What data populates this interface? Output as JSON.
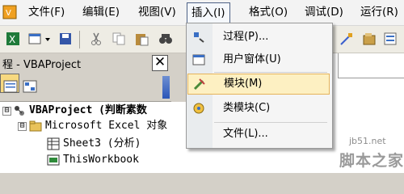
{
  "menubar": {
    "items": [
      {
        "label": "文件(F)"
      },
      {
        "label": "编辑(E)"
      },
      {
        "label": "视图(V)"
      },
      {
        "label": "插入(I)"
      },
      {
        "label": "格式(O)"
      },
      {
        "label": "调试(D)"
      },
      {
        "label": "运行(R)"
      }
    ]
  },
  "insert_menu": {
    "items": [
      {
        "label": "过程(P)...",
        "icon": "procedure-icon"
      },
      {
        "label": "用户窗体(U)",
        "icon": "userform-icon"
      },
      {
        "label": "模块(M)",
        "icon": "module-icon",
        "highlighted": true
      },
      {
        "label": "类模块(C)",
        "icon": "class-module-icon"
      },
      {
        "label": "文件(L)...",
        "icon": "file-icon"
      }
    ]
  },
  "project_explorer": {
    "title": "程 - VBAProject",
    "close_glyph": "✕",
    "tree": [
      {
        "label": "VBAProject (判断素数",
        "expander": "⊟"
      },
      {
        "label": "Microsoft Excel 对象",
        "expander": "⊟"
      },
      {
        "label": "Sheet3 (分析)"
      },
      {
        "label": "ThisWorkbook"
      }
    ]
  },
  "watermark": {
    "url": "jb51.net",
    "brand": "脚本之家"
  },
  "colors": {
    "menu_open_border": "#4d6185",
    "highlight_fill": "#fdf0c2",
    "highlight_border": "#e6b35a"
  }
}
